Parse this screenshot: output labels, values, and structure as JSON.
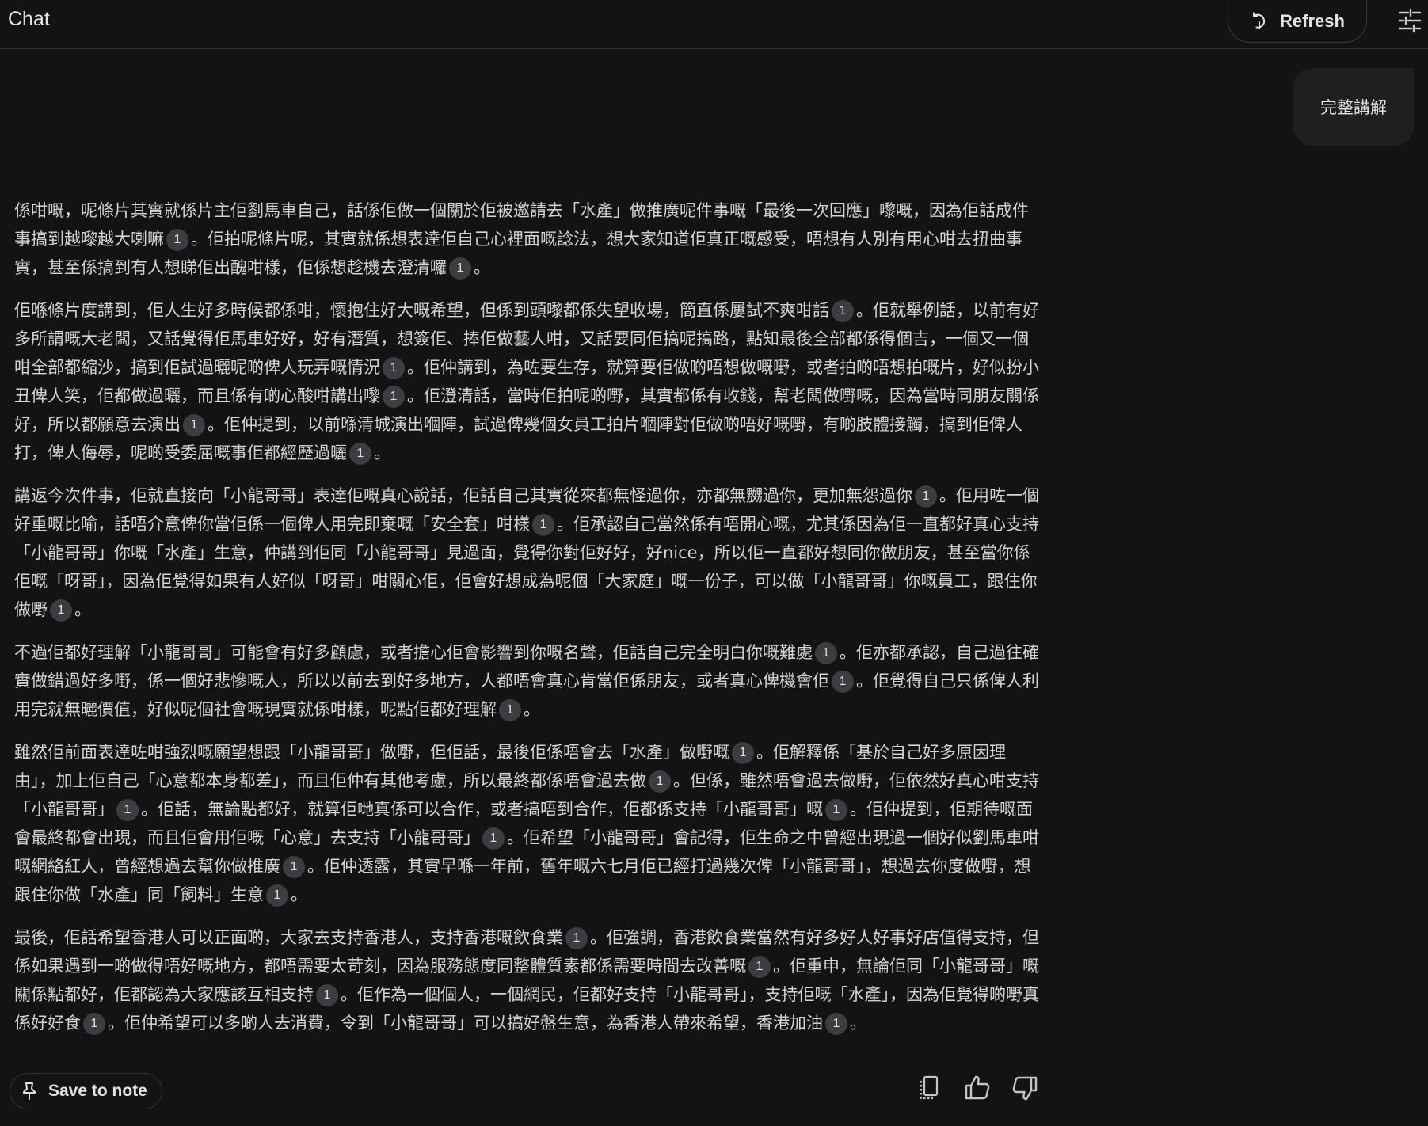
{
  "header": {
    "title": "Chat",
    "refresh_label": "Refresh"
  },
  "user_message": "完整講解",
  "cite_label": "1",
  "response": {
    "paragraphs": [
      [
        {
          "t": "係咁嘅，呢條片其實就係片主佢劉馬車自己，話係佢做一個關於佢被邀請去「水產」做推廣呢件事嘅「最後一次回應」嚟嘅，因為佢話成件事搞到越嚟越大喇嘛"
        },
        {
          "c": true
        },
        {
          "t": "。佢拍呢條片呢，其實就係想表達佢自己心裡面嘅諗法，想大家知道佢真正嘅感受，唔想有人別有用心咁去扭曲事實，甚至係搞到有人想睇佢出醜咁樣，佢係想趁機去澄清囉"
        },
        {
          "c": true
        },
        {
          "t": "。"
        }
      ],
      [
        {
          "t": "佢喺條片度講到，佢人生好多時候都係咁，懷抱住好大嘅希望，但係到頭嚟都係失望收場，簡直係屢試不爽咁話"
        },
        {
          "c": true
        },
        {
          "t": "。佢就舉例話，以前有好多所謂嘅大老闆，又話覺得佢馬車好好，好有潛質，想簽佢、捧佢做藝人咁，又話要同佢搞呢搞路，點知最後全部都係得個吉，一個又一個咁全部都縮沙，搞到佢試過曬呢啲俾人玩弄嘅情況"
        },
        {
          "c": true
        },
        {
          "t": "。佢仲講到，為咗要生存，就算要佢做啲唔想做嘅嘢，或者拍啲唔想拍嘅片，好似扮小丑俾人笑，佢都做過曬，而且係有啲心酸咁講出嚟"
        },
        {
          "c": true
        },
        {
          "t": "。佢澄清話，當時佢拍呢啲嘢，其實都係有收錢，幫老闆做嘢嘅，因為當時同朋友關係好，所以都願意去演出"
        },
        {
          "c": true
        },
        {
          "t": "。佢仲提到，以前喺清城演出嗰陣，試過俾幾個女員工拍片嗰陣對佢做啲唔好嘅嘢，有啲肢體接觸，搞到佢俾人打，俾人侮辱，呢啲受委屈嘅事佢都經歷過曬"
        },
        {
          "c": true
        },
        {
          "t": "。"
        }
      ],
      [
        {
          "t": "講返今次件事，佢就直接向「小龍哥哥」表達佢嘅真心說話，佢話自己其實從來都無怪過你，亦都無嬲過你，更加無怨過你"
        },
        {
          "c": true
        },
        {
          "t": "。佢用咗一個好重嘅比喻，話唔介意俾你當佢係一個俾人用完即棄嘅「安全套」咁樣"
        },
        {
          "c": true
        },
        {
          "t": "。佢承認自己當然係有唔開心嘅，尤其係因為佢一直都好真心支持「小龍哥哥」你嘅「水產」生意，仲講到佢同「小龍哥哥」見過面，覺得你對佢好好，好nice，所以佢一直都好想同你做朋友，甚至當你係佢嘅「呀哥」，因為佢覺得如果有人好似「呀哥」咁關心佢，佢會好想成為呢個「大家庭」嘅一份子，可以做「小龍哥哥」你嘅員工，跟住你做嘢"
        },
        {
          "c": true
        },
        {
          "t": "。"
        }
      ],
      [
        {
          "t": "不過佢都好理解「小龍哥哥」可能會有好多顧慮，或者擔心佢會影響到你嘅名聲，佢話自己完全明白你嘅難處"
        },
        {
          "c": true
        },
        {
          "t": "。佢亦都承認，自己過往確實做錯過好多嘢，係一個好悲慘嘅人，所以以前去到好多地方，人都唔會真心肯當佢係朋友，或者真心俾機會佢"
        },
        {
          "c": true
        },
        {
          "t": "。佢覺得自己只係俾人利用完就無曬價值，好似呢個社會嘅現實就係咁樣，呢點佢都好理解"
        },
        {
          "c": true
        },
        {
          "t": "。"
        }
      ],
      [
        {
          "t": "雖然佢前面表達咗咁強烈嘅願望想跟「小龍哥哥」做嘢，但佢話，最後佢係唔會去「水產」做嘢嘅"
        },
        {
          "c": true
        },
        {
          "t": "。佢解釋係「基於自己好多原因理由」，加上佢自己「心意都本身都差」，而且佢仲有其他考慮，所以最終都係唔會過去做"
        },
        {
          "c": true
        },
        {
          "t": "。但係，雖然唔會過去做嘢，佢依然好真心咁支持「小龍哥哥」"
        },
        {
          "c": true
        },
        {
          "t": "。佢話，無論點都好，就算佢哋真係可以合作，或者搞唔到合作，佢都係支持「小龍哥哥」嘅"
        },
        {
          "c": true
        },
        {
          "t": "。佢仲提到，佢期待嘅面會最終都會出現，而且佢會用佢嘅「心意」去支持「小龍哥哥」"
        },
        {
          "c": true
        },
        {
          "t": "。佢希望「小龍哥哥」會記得，佢生命之中曾經出現過一個好似劉馬車咁嘅網絡紅人，曾經想過去幫你做推廣"
        },
        {
          "c": true
        },
        {
          "t": "。佢仲透露，其實早喺一年前，舊年嘅六七月佢已經打過幾次俾「小龍哥哥」，想過去你度做嘢，想跟住你做「水產」同「飼料」生意"
        },
        {
          "c": true
        },
        {
          "t": "。"
        }
      ],
      [
        {
          "t": "最後，佢話希望香港人可以正面啲，大家去支持香港人，支持香港嘅飲食業"
        },
        {
          "c": true
        },
        {
          "t": "。佢強調，香港飲食業當然有好多好人好事好店值得支持，但係如果遇到一啲做得唔好嘅地方，都唔需要太苛刻，因為服務態度同整體質素都係需要時間去改善嘅"
        },
        {
          "c": true
        },
        {
          "t": "。佢重申，無論佢同「小龍哥哥」嘅關係點都好，佢都認為大家應該互相支持"
        },
        {
          "c": true
        },
        {
          "t": "。佢作為一個個人，一個網民，佢都好支持「小龍哥哥」，支持佢嘅「水產」，因為佢覺得啲嘢真係好好食"
        },
        {
          "c": true
        },
        {
          "t": "。佢仲希望可以多啲人去消費，令到「小龍哥哥」可以搞好盤生意，為香港人帶來希望，香港加油"
        },
        {
          "c": true
        },
        {
          "t": "。"
        }
      ]
    ]
  },
  "footer": {
    "save_label": "Save to note"
  },
  "icons": {
    "refresh": "refresh-icon",
    "tune": "tune-icon",
    "pin": "pin-icon",
    "copy": "copy-icon",
    "thumbs_up": "thumbs-up-icon",
    "thumbs_down": "thumbs-down-icon"
  },
  "colors": {
    "background": "#131314",
    "bubble": "#1e1f20",
    "citation_chip": "#3c3d40",
    "text": "#e3e3e3"
  }
}
